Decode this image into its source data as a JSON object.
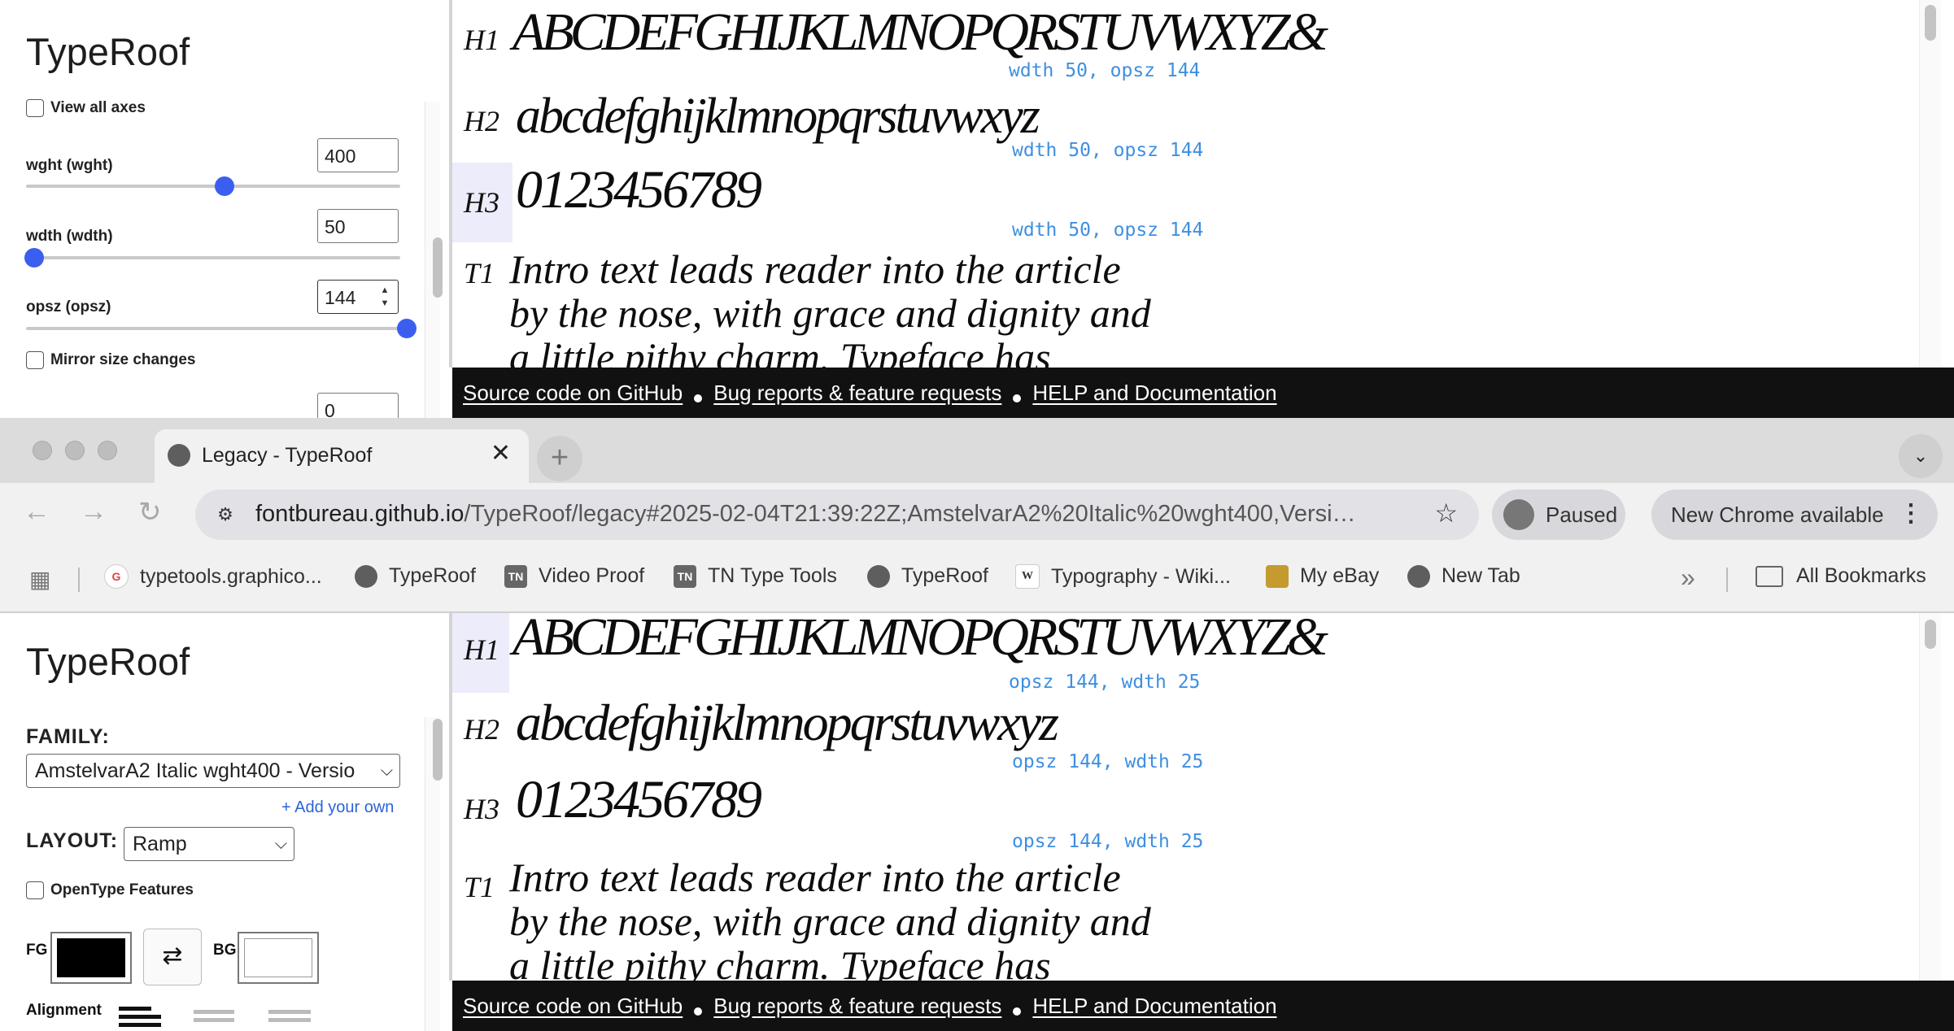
{
  "top_window": {
    "sidebar": {
      "title": "TypeRoof",
      "view_all_axes": "View all axes",
      "axes": [
        {
          "label": "wght (wght)",
          "value": "400",
          "level": 0.51
        },
        {
          "label": "wdth (wdth)",
          "value": "50",
          "level": 0.0
        },
        {
          "label": "opsz (opsz)",
          "value": "144",
          "level": 1.0
        }
      ],
      "mirror_label": "Mirror size changes",
      "partial_value": "0"
    },
    "rows": [
      {
        "label": "H1",
        "specimen": "ABCDEFGHIJKLMNOPQRSTUVWXYZ&",
        "note": "wdth 50, opsz 144"
      },
      {
        "label": "H2",
        "specimen": "abcdefghijklmnopqrstuvwxyz",
        "note": "wdth 50, opsz 144"
      },
      {
        "label": "H3",
        "specimen": "0123456789",
        "note": "wdth 50, opsz 144"
      },
      {
        "label": "T1",
        "text": "Intro text leads reader into the article\nby the nose, with grace and dignity and\na little pithy charm. Typeface has"
      }
    ]
  },
  "footer": {
    "source": "Source code on GitHub",
    "bugs": "Bug reports & feature requests",
    "help": "HELP and Documentation"
  },
  "browser": {
    "tab_title": "Legacy - TypeRoof",
    "url_host": "fontbureau.github.io",
    "url_rest": "/TypeRoof/legacy#2025-02-04T21:39:22Z;AmstelvarA2%20Italic%20wght400,Versi…",
    "profile_label": "Paused",
    "update_label": "New Chrome available",
    "bookmarks": [
      {
        "label": "typetools.graphico...",
        "icon": "google-icon"
      },
      {
        "label": "TypeRoof",
        "icon": "globe-icon"
      },
      {
        "label": "Video Proof",
        "icon": "tn-icon"
      },
      {
        "label": "TN Type Tools",
        "icon": "tn-icon"
      },
      {
        "label": "TypeRoof",
        "icon": "globe-icon"
      },
      {
        "label": "Typography - Wiki...",
        "icon": "wikipedia-icon"
      },
      {
        "label": "My eBay",
        "icon": "shopping-bag-icon"
      },
      {
        "label": "New Tab",
        "icon": "globe-icon"
      }
    ],
    "more_label": "»",
    "all_bookmarks": "All Bookmarks"
  },
  "bottom_window": {
    "sidebar": {
      "title": "TypeRoof",
      "family_label": "FAMILY:",
      "family_value": "AmstelvarA2 Italic wght400 - Versio",
      "add_own": "+ Add your own",
      "layout_label": "LAYOUT:",
      "layout_value": "Ramp",
      "opentype_label": "OpenType Features",
      "fg_label": "FG",
      "bg_label": "BG",
      "fg_color": "#000000",
      "bg_color": "#ffffff",
      "alignment_label": "Alignment"
    },
    "rows": [
      {
        "label": "H1",
        "specimen": "ABCDEFGHIJKLMNOPQRSTUVWXYZ&",
        "note": "opsz 144, wdth 25"
      },
      {
        "label": "H2",
        "specimen": "abcdefghijklmnopqrstuvwxyz",
        "note": "opsz 144, wdth 25"
      },
      {
        "label": "H3",
        "specimen": "0123456789",
        "note": "opsz 144, wdth 25"
      },
      {
        "label": "T1",
        "text": "Intro text leads reader into the article\nby the nose, with grace and dignity and\na little pithy charm. Typeface has"
      }
    ]
  }
}
